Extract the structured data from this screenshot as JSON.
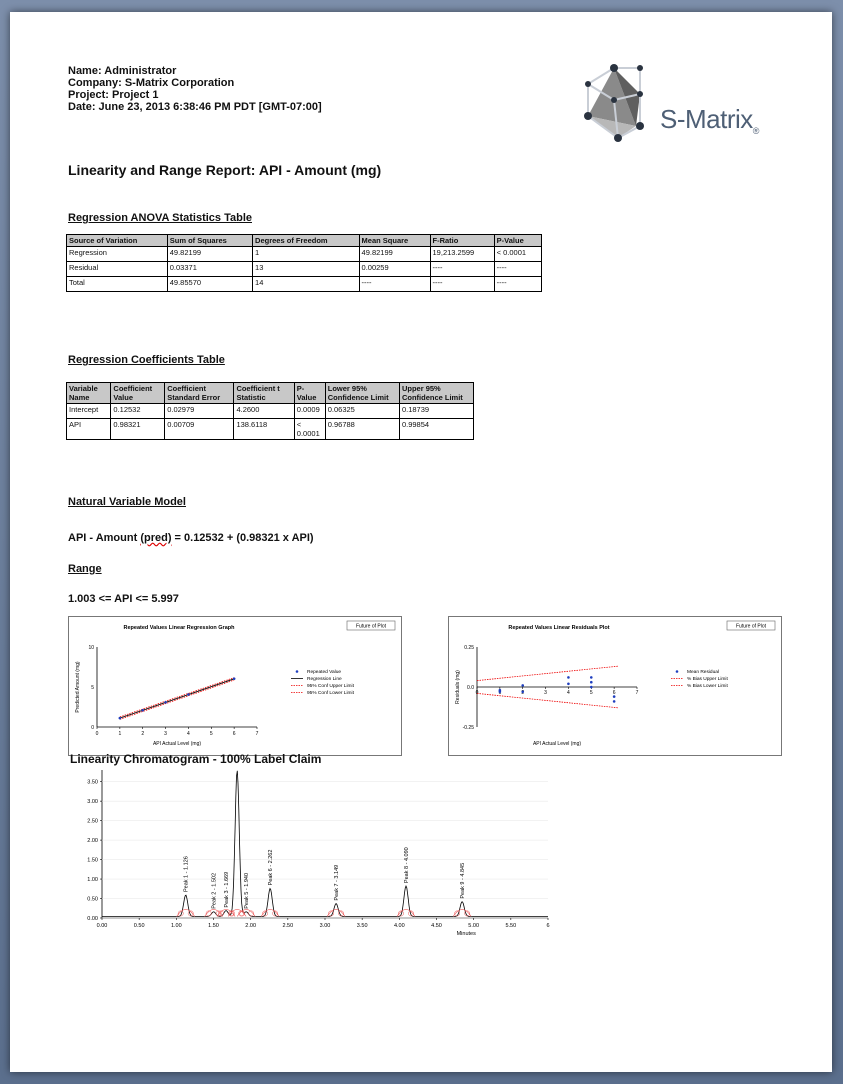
{
  "header": {
    "name": "Name: Administrator",
    "company": "Company: S-Matrix Corporation",
    "project": "Project: Project 1",
    "date": "Date: June 23, 2013 6:38:46 PM PDT [GMT-07:00]"
  },
  "logo": {
    "text": "S-Matrix",
    "mark": "®"
  },
  "report_title": "Linearity and Range Report: API - Amount (mg)",
  "anova": {
    "heading": "Regression ANOVA Statistics Table",
    "columns": [
      "Source of Variation",
      "Sum of Squares",
      "Degrees of Freedom",
      "Mean Square",
      "F-Ratio",
      "P-Value"
    ],
    "rows": [
      [
        "Regression",
        "49.82199",
        "1",
        "49.82199",
        "19,213.2599",
        "< 0.0001"
      ],
      [
        "Residual",
        "0.03371",
        "13",
        "0.00259",
        "----",
        "----"
      ],
      [
        "Total",
        "49.85570",
        "14",
        "----",
        "----",
        "----"
      ]
    ]
  },
  "coefficients": {
    "heading": "Regression Coefficients Table",
    "columns": [
      "Variable Name",
      "Coefficient Value",
      "Coefficient Standard Error",
      "Coefficient t Statistic",
      "P-Value",
      "Lower 95% Confidence Limit",
      "Upper 95% Confidence Limit"
    ],
    "rows": [
      [
        "Intercept",
        "0.12532",
        "0.02979",
        "4.2600",
        "0.0009",
        "0.06325",
        "0.18739"
      ],
      [
        "API",
        "0.98321",
        "0.00709",
        "138.6118",
        "< 0.0001",
        "0.96788",
        "0.99854"
      ]
    ]
  },
  "model": {
    "heading": "Natural Variable Model",
    "formula_prefix": "API - Amount ",
    "formula_underlined": "(pred)",
    "formula_suffix": " = 0.12532 + (0.98321 x API)"
  },
  "range": {
    "heading": "Range",
    "text": "1.003 <= API <= 5.997"
  },
  "chart_data": [
    {
      "type": "line",
      "title": "Repeated Values Linear Regression Graph",
      "button": "Future of Plot",
      "xlabel": "API Actual Level (mg)",
      "ylabel": "Predicted Amount (mg)",
      "xlim": [
        0,
        7
      ],
      "ylim": [
        0,
        10
      ],
      "x_ticks": [
        "0",
        "1",
        "2",
        "3",
        "4",
        "5",
        "6",
        "7"
      ],
      "y_ticks": [
        "0",
        "5",
        "10"
      ],
      "legend": [
        "Repeated Value",
        "Regression Line",
        "95% Conf Upper Limit",
        "95% Conf Lower Limit"
      ],
      "legend_position": "right",
      "series": [
        {
          "name": "Repeated Value",
          "x": [
            1,
            1,
            1,
            2,
            2,
            2,
            3,
            3,
            3,
            4,
            4,
            4,
            6,
            6,
            6
          ],
          "y": [
            1.11,
            1.1,
            1.12,
            2.09,
            2.1,
            2.08,
            3.08,
            3.07,
            3.09,
            4.06,
            4.05,
            4.07,
            6.03,
            6.02,
            6.04
          ]
        },
        {
          "name": "Regression Line",
          "x": [
            1,
            6
          ],
          "y": [
            1.11,
            6.02
          ]
        }
      ]
    },
    {
      "type": "scatter",
      "title": "Repeated Values Linear Residuals Plot",
      "button": "Future of Plot",
      "xlabel": "API Actual Level (mg)",
      "ylabel": "Residuals (mg)",
      "xlim": [
        0,
        7
      ],
      "ylim": [
        -0.25,
        0.25
      ],
      "x_ticks": [
        "0",
        "1",
        "2",
        "3",
        "4",
        "5",
        "6",
        "7"
      ],
      "y_ticks": [
        "0.25",
        "0.0",
        "-0.25"
      ],
      "legend": [
        "Mean Residual",
        "% Bias Upper Limit",
        "% Bias Lower Limit"
      ],
      "legend_position": "right",
      "series": [
        {
          "name": "Mean Residual",
          "x": [
            1,
            1,
            2,
            2,
            4,
            4,
            5,
            5,
            5,
            6,
            6
          ],
          "y": [
            -0.02,
            -0.03,
            0.01,
            -0.03,
            0.06,
            0.02,
            0.06,
            0.03,
            0.0,
            -0.06,
            -0.09
          ]
        }
      ]
    },
    {
      "type": "line",
      "title": "Linearity Chromatogram - 100% Label Claim",
      "xlabel": "Minutes",
      "ylabel": "",
      "xlim": [
        0,
        6
      ],
      "ylim": [
        0,
        3.8
      ],
      "x_ticks": [
        "0.00",
        "0.50",
        "1.00",
        "1.50",
        "2.00",
        "2.50",
        "3.00",
        "3.50",
        "4.00",
        "4.50",
        "5.00",
        "5.50",
        "6"
      ],
      "y_ticks": [
        "0.00",
        "0.50",
        "1.00",
        "1.50",
        "2.00",
        "2.50",
        "3.00",
        "3.50"
      ],
      "peaks": [
        {
          "label": "Peak 1 - 1.126",
          "x": 1.126,
          "y": 0.55
        },
        {
          "label": "Peak 2 - 1.502",
          "x": 1.502,
          "y": 0.12
        },
        {
          "label": "Peak 3 - 1.669",
          "x": 1.669,
          "y": 0.15
        },
        {
          "label": "Peak 4 - 1.818",
          "x": 1.818,
          "y": 3.75
        },
        {
          "label": "Peak 5 - 1.940",
          "x": 1.94,
          "y": 0.12
        },
        {
          "label": "Peak 6 - 2.262",
          "x": 2.262,
          "y": 0.72
        },
        {
          "label": "Peak 7 - 3.149",
          "x": 3.149,
          "y": 0.33
        },
        {
          "label": "Peak 8 - 4.090",
          "x": 4.09,
          "y": 0.78
        },
        {
          "label": "Peak 9 - 4.845",
          "x": 4.845,
          "y": 0.38
        }
      ]
    }
  ]
}
